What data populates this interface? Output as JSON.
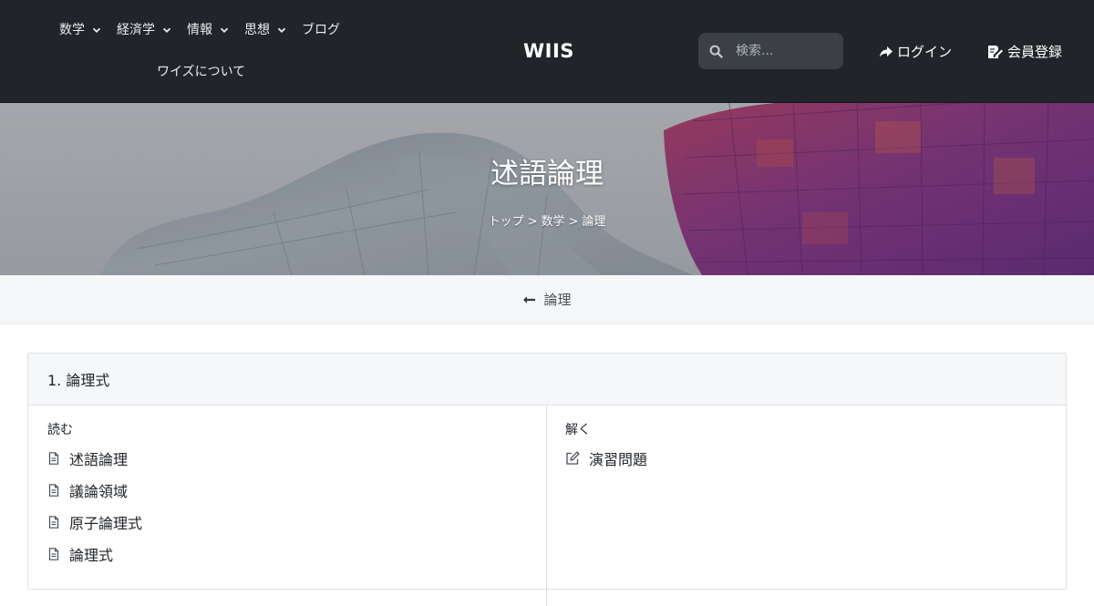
{
  "header": {
    "nav": [
      {
        "label": "数学",
        "has_dropdown": true
      },
      {
        "label": "経済学",
        "has_dropdown": true
      },
      {
        "label": "情報",
        "has_dropdown": true
      },
      {
        "label": "思想",
        "has_dropdown": true
      },
      {
        "label": "ブログ",
        "has_dropdown": false
      },
      {
        "label": "ワイズについて",
        "has_dropdown": false
      }
    ],
    "brand": "WIIS",
    "search": {
      "placeholder": "検索...",
      "value": "",
      "icon": "search-icon"
    },
    "login_label": "ログイン",
    "register_label": "会員登録"
  },
  "hero": {
    "title": "述語論理",
    "breadcrumb": [
      "トップ",
      "数学",
      "論理"
    ],
    "breadcrumb_separator": ">"
  },
  "back": {
    "label": "論理",
    "icon": "arrow-left-icon"
  },
  "section": {
    "title": "1. 論理式",
    "read": {
      "title": "読む",
      "items": [
        "述語論理",
        "議論領域",
        "原子論理式",
        "論理式"
      ],
      "icon": "document-icon"
    },
    "solve": {
      "title": "解く",
      "items": [
        "演習問題"
      ],
      "icon": "edit-icon"
    }
  },
  "colors": {
    "navbar_bg": "#212529",
    "search_bg": "#3c4045",
    "subbar_bg": "#f6f7f9",
    "border": "#dee2e6"
  }
}
